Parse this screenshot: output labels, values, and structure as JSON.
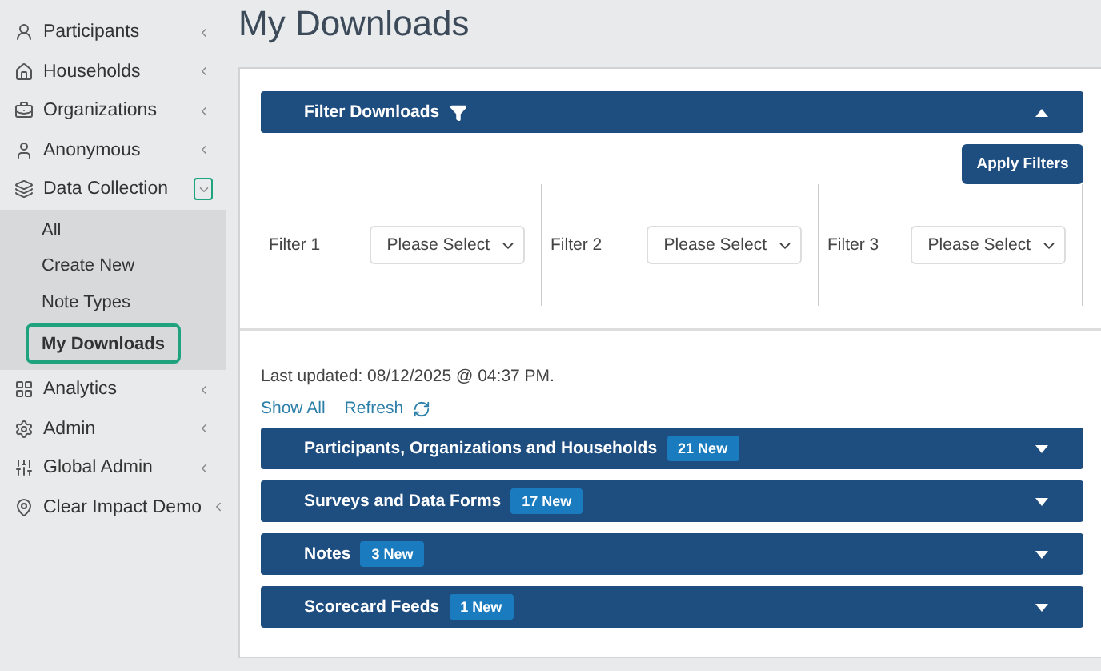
{
  "sidebar": {
    "items": [
      {
        "label": "Participants",
        "expanded": false
      },
      {
        "label": "Households",
        "expanded": false
      },
      {
        "label": "Organizations",
        "expanded": false
      },
      {
        "label": "Anonymous",
        "expanded": false
      },
      {
        "label": "Data Collection",
        "expanded": true,
        "children": [
          {
            "label": "All",
            "selected": false
          },
          {
            "label": "Create New",
            "selected": false
          },
          {
            "label": "Note Types",
            "selected": false
          },
          {
            "label": "My Downloads",
            "selected": true
          }
        ]
      },
      {
        "label": "Analytics",
        "expanded": false
      },
      {
        "label": "Admin",
        "expanded": false
      },
      {
        "label": "Global Admin",
        "expanded": false
      },
      {
        "label": "Clear Impact Demo",
        "expanded": false
      }
    ]
  },
  "page_title": "My Downloads",
  "filter_panel": {
    "title": "Filter Downloads",
    "expanded": true,
    "apply_button": "Apply Filters",
    "filters": [
      {
        "label": "Filter 1",
        "value": "Please Select"
      },
      {
        "label": "Filter 2",
        "value": "Please Select"
      },
      {
        "label": "Filter 3",
        "value": "Please Select"
      }
    ]
  },
  "last_updated": "Last updated: 08/12/2025 @ 04:37 PM.",
  "links": {
    "show_all": "Show All",
    "refresh": "Refresh"
  },
  "sections": [
    {
      "title": "Participants, Organizations and Households",
      "badge": "21 New",
      "expanded": false
    },
    {
      "title": "Surveys and Data Forms",
      "badge": "17 New",
      "expanded": false
    },
    {
      "title": "Notes",
      "badge": "3 New",
      "expanded": false
    },
    {
      "title": "Scorecard Feeds",
      "badge": "1 New",
      "expanded": false
    }
  ]
}
